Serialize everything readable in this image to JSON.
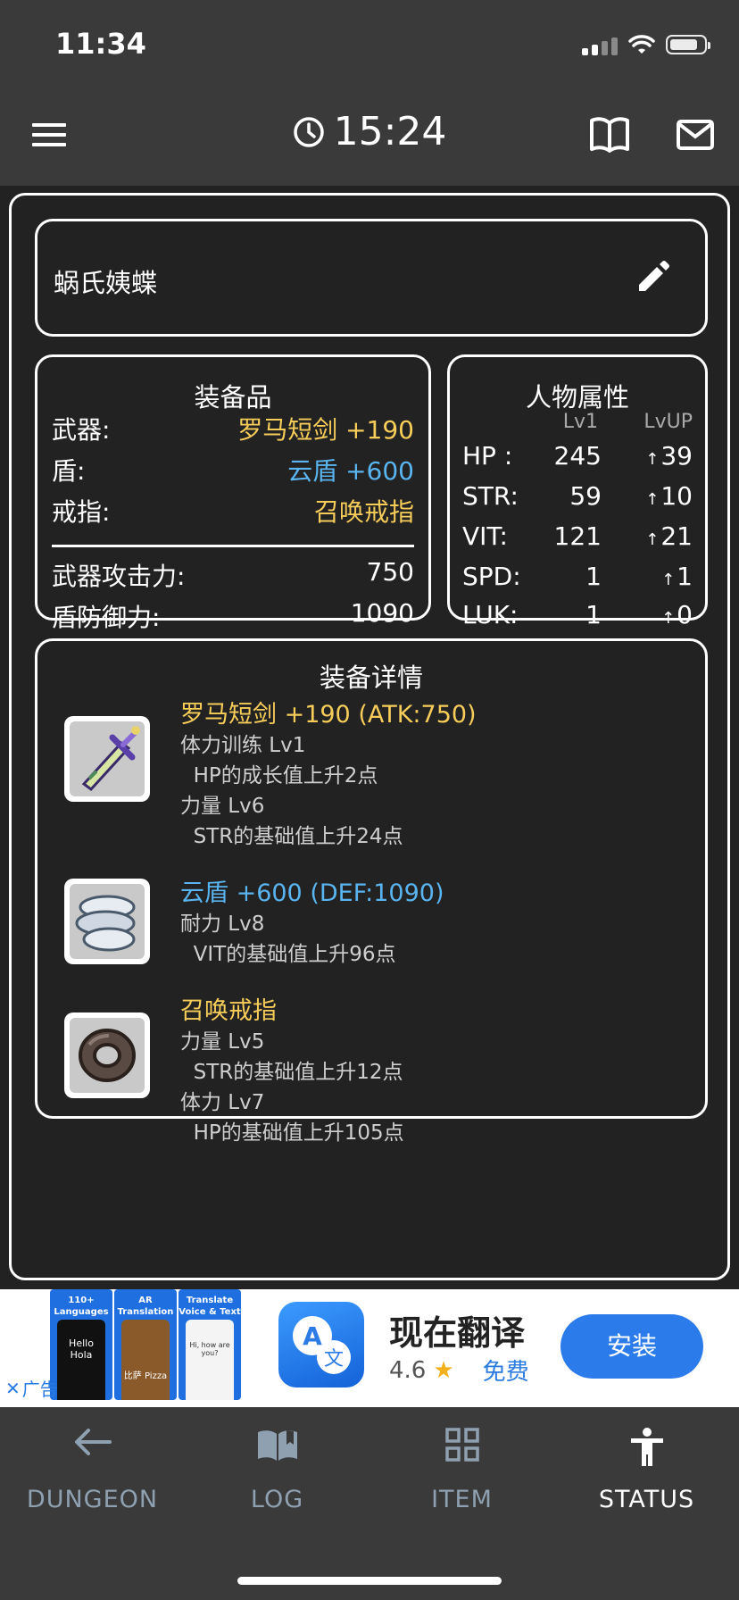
{
  "status_bar": {
    "time": "11:34"
  },
  "header": {
    "timer": "15:24"
  },
  "character": {
    "name": "蜗氏姨蝶"
  },
  "equipment": {
    "title": "装备品",
    "weapon_label": "武器:",
    "weapon_value": "罗马短剑 +190",
    "shield_label": "盾:",
    "shield_value": "云盾 +600",
    "ring_label": "戒指:",
    "ring_value": "召唤戒指",
    "atk_label": "武器攻击力:",
    "atk_value": "750",
    "def_label": "盾防御力:",
    "def_value": "1090"
  },
  "attributes": {
    "title": "人物属性",
    "col_lv1": "Lv1",
    "col_lvup": "LvUP",
    "rows": [
      {
        "label": "HP :",
        "value": "245",
        "up": "39"
      },
      {
        "label": "STR:",
        "value": "59",
        "up": "10"
      },
      {
        "label": "VIT:",
        "value": "121",
        "up": "21"
      },
      {
        "label": "SPD:",
        "value": "1",
        "up": "1"
      },
      {
        "label": "LUK:",
        "value": "1",
        "up": "0"
      }
    ]
  },
  "details": {
    "title": "装备详情",
    "items": [
      {
        "name": "罗马短剑 +190 (ATK:750)",
        "lines": [
          "体力训练 Lv1",
          "  HP的成长值上升2点",
          "力量 Lv6",
          "  STR的基础值上升24点"
        ]
      },
      {
        "name": "云盾 +600 (DEF:1090)",
        "lines": [
          "耐力 Lv8",
          "  VIT的基础值上升96点"
        ]
      },
      {
        "name": "召唤戒指",
        "lines": [
          "力量 Lv5",
          "  STR的基础值上升12点",
          "体力 Lv7",
          "  HP的基础值上升105点"
        ]
      }
    ]
  },
  "ad": {
    "close_label": "广告",
    "shots": [
      {
        "caption": "110+ Languages",
        "phone_text": "Hello Hola"
      },
      {
        "caption": "AR Translation",
        "phone_text": "比萨 Pizza"
      },
      {
        "caption": "Translate Voice & Text",
        "phone_text": "Hi, how are you?"
      }
    ],
    "app_title": "现在翻译",
    "rating": "4.6",
    "price": "免费",
    "install_label": "安装"
  },
  "nav": {
    "items": [
      {
        "label": "DUNGEON",
        "icon": "arrow-left-icon"
      },
      {
        "label": "LOG",
        "icon": "open-book-icon"
      },
      {
        "label": "ITEM",
        "icon": "grid-icon"
      },
      {
        "label": "STATUS",
        "icon": "person-icon"
      }
    ],
    "active": "STATUS"
  },
  "colors": {
    "background": "#222222",
    "bar": "#3a3a3a",
    "weapon_yellow": "#f7cd5a",
    "shield_blue": "#5ab4f0",
    "install_blue": "#2b7cea"
  }
}
